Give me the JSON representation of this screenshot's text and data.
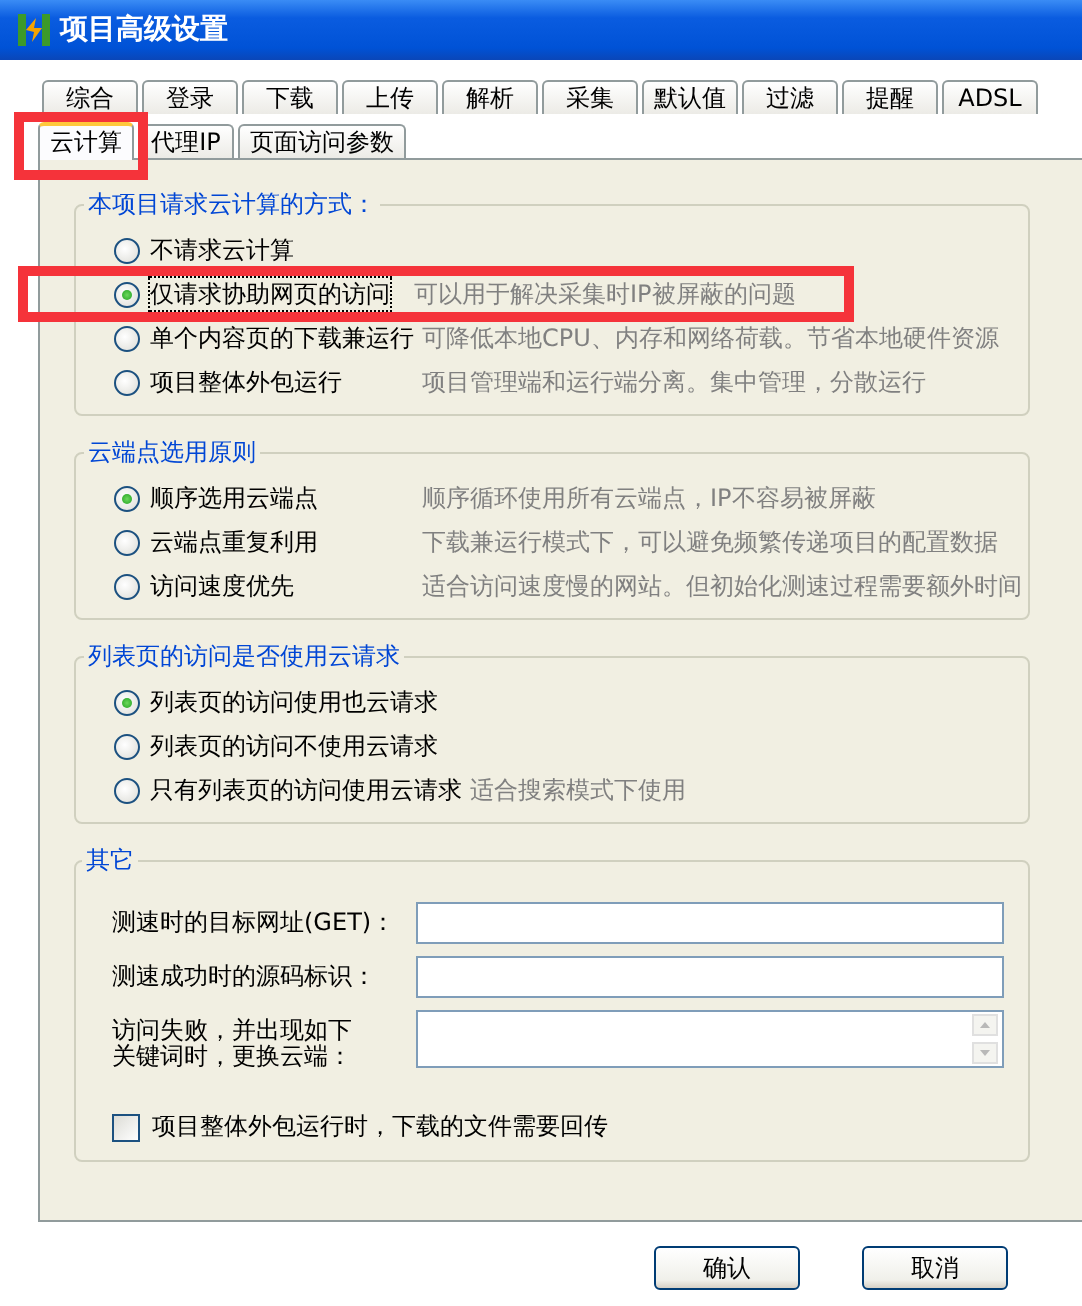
{
  "window": {
    "title": "项目高级设置"
  },
  "tab_rows": [
    [
      {
        "label": "综合",
        "selected": false,
        "highlighted": false
      },
      {
        "label": "登录",
        "selected": false,
        "highlighted": false
      },
      {
        "label": "下载",
        "selected": false,
        "highlighted": false
      },
      {
        "label": "上传",
        "selected": false,
        "highlighted": false
      },
      {
        "label": "解析",
        "selected": false,
        "highlighted": false
      },
      {
        "label": "采集",
        "selected": false,
        "highlighted": false
      },
      {
        "label": "默认值",
        "selected": false,
        "highlighted": false
      },
      {
        "label": "过滤",
        "selected": false,
        "highlighted": false
      },
      {
        "label": "提醒",
        "selected": false,
        "highlighted": false
      },
      {
        "label": "ADSL",
        "selected": false,
        "highlighted": false
      }
    ],
    [
      {
        "label": "云计算",
        "selected": true,
        "highlighted": true
      },
      {
        "label": "代理IP",
        "selected": false,
        "highlighted": false
      },
      {
        "label": "页面访问参数",
        "selected": false,
        "highlighted": false
      }
    ]
  ],
  "groups": [
    {
      "title": "本项目请求云计算的方式：",
      "options": [
        {
          "label": "不请求云计算",
          "selected": false,
          "highlighted": false
        },
        {
          "label": "仅请求协助网页的访问",
          "hint": "可以用于解决采集时IP被屏蔽的问题",
          "selected": true,
          "highlighted": true
        },
        {
          "label": "单个内容页的下载兼运行",
          "hint": "可降低本地CPU、内存和网络荷载。节省本地硬件资源",
          "selected": false,
          "highlighted": false
        },
        {
          "label": "项目整体外包运行",
          "hint": "项目管理端和运行端分离。集中管理，分散运行",
          "selected": false,
          "highlighted": false
        }
      ]
    },
    {
      "title": "云端点选用原则",
      "options": [
        {
          "label": "顺序选用云端点",
          "hint": "顺序循环使用所有云端点，IP不容易被屏蔽",
          "selected": true,
          "highlighted": false
        },
        {
          "label": "云端点重复利用",
          "hint": "下载兼运行模式下，可以避免频繁传递项目的配置数据",
          "selected": false,
          "highlighted": false
        },
        {
          "label": "访问速度优先",
          "hint": "适合访问速度慢的网站。但初始化测速过程需要额外时间",
          "selected": false,
          "highlighted": false
        }
      ]
    },
    {
      "title": "列表页的访问是否使用云请求",
      "options": [
        {
          "label": "列表页的访问使用也云请求",
          "selected": true,
          "highlighted": false
        },
        {
          "label": "列表页的访问不使用云请求",
          "selected": false,
          "highlighted": false
        },
        {
          "label": "只有列表页的访问使用云请求",
          "hint": "适合搜索模式下使用",
          "selected": false,
          "highlighted": false
        }
      ]
    },
    {
      "title": "其它",
      "fields": [
        {
          "label": "测速时的目标网址(GET)：",
          "kind": "line"
        },
        {
          "label": "测速成功时的源码标识：",
          "kind": "line"
        },
        {
          "label": "访问失败，并出现如下关键词时，更换云端：",
          "kind": "multiline"
        }
      ],
      "checkbox": {
        "label": "项目整体外包运行时，下载的文件需要回传",
        "checked": false
      }
    }
  ],
  "buttons": [
    "确认",
    "取消"
  ]
}
